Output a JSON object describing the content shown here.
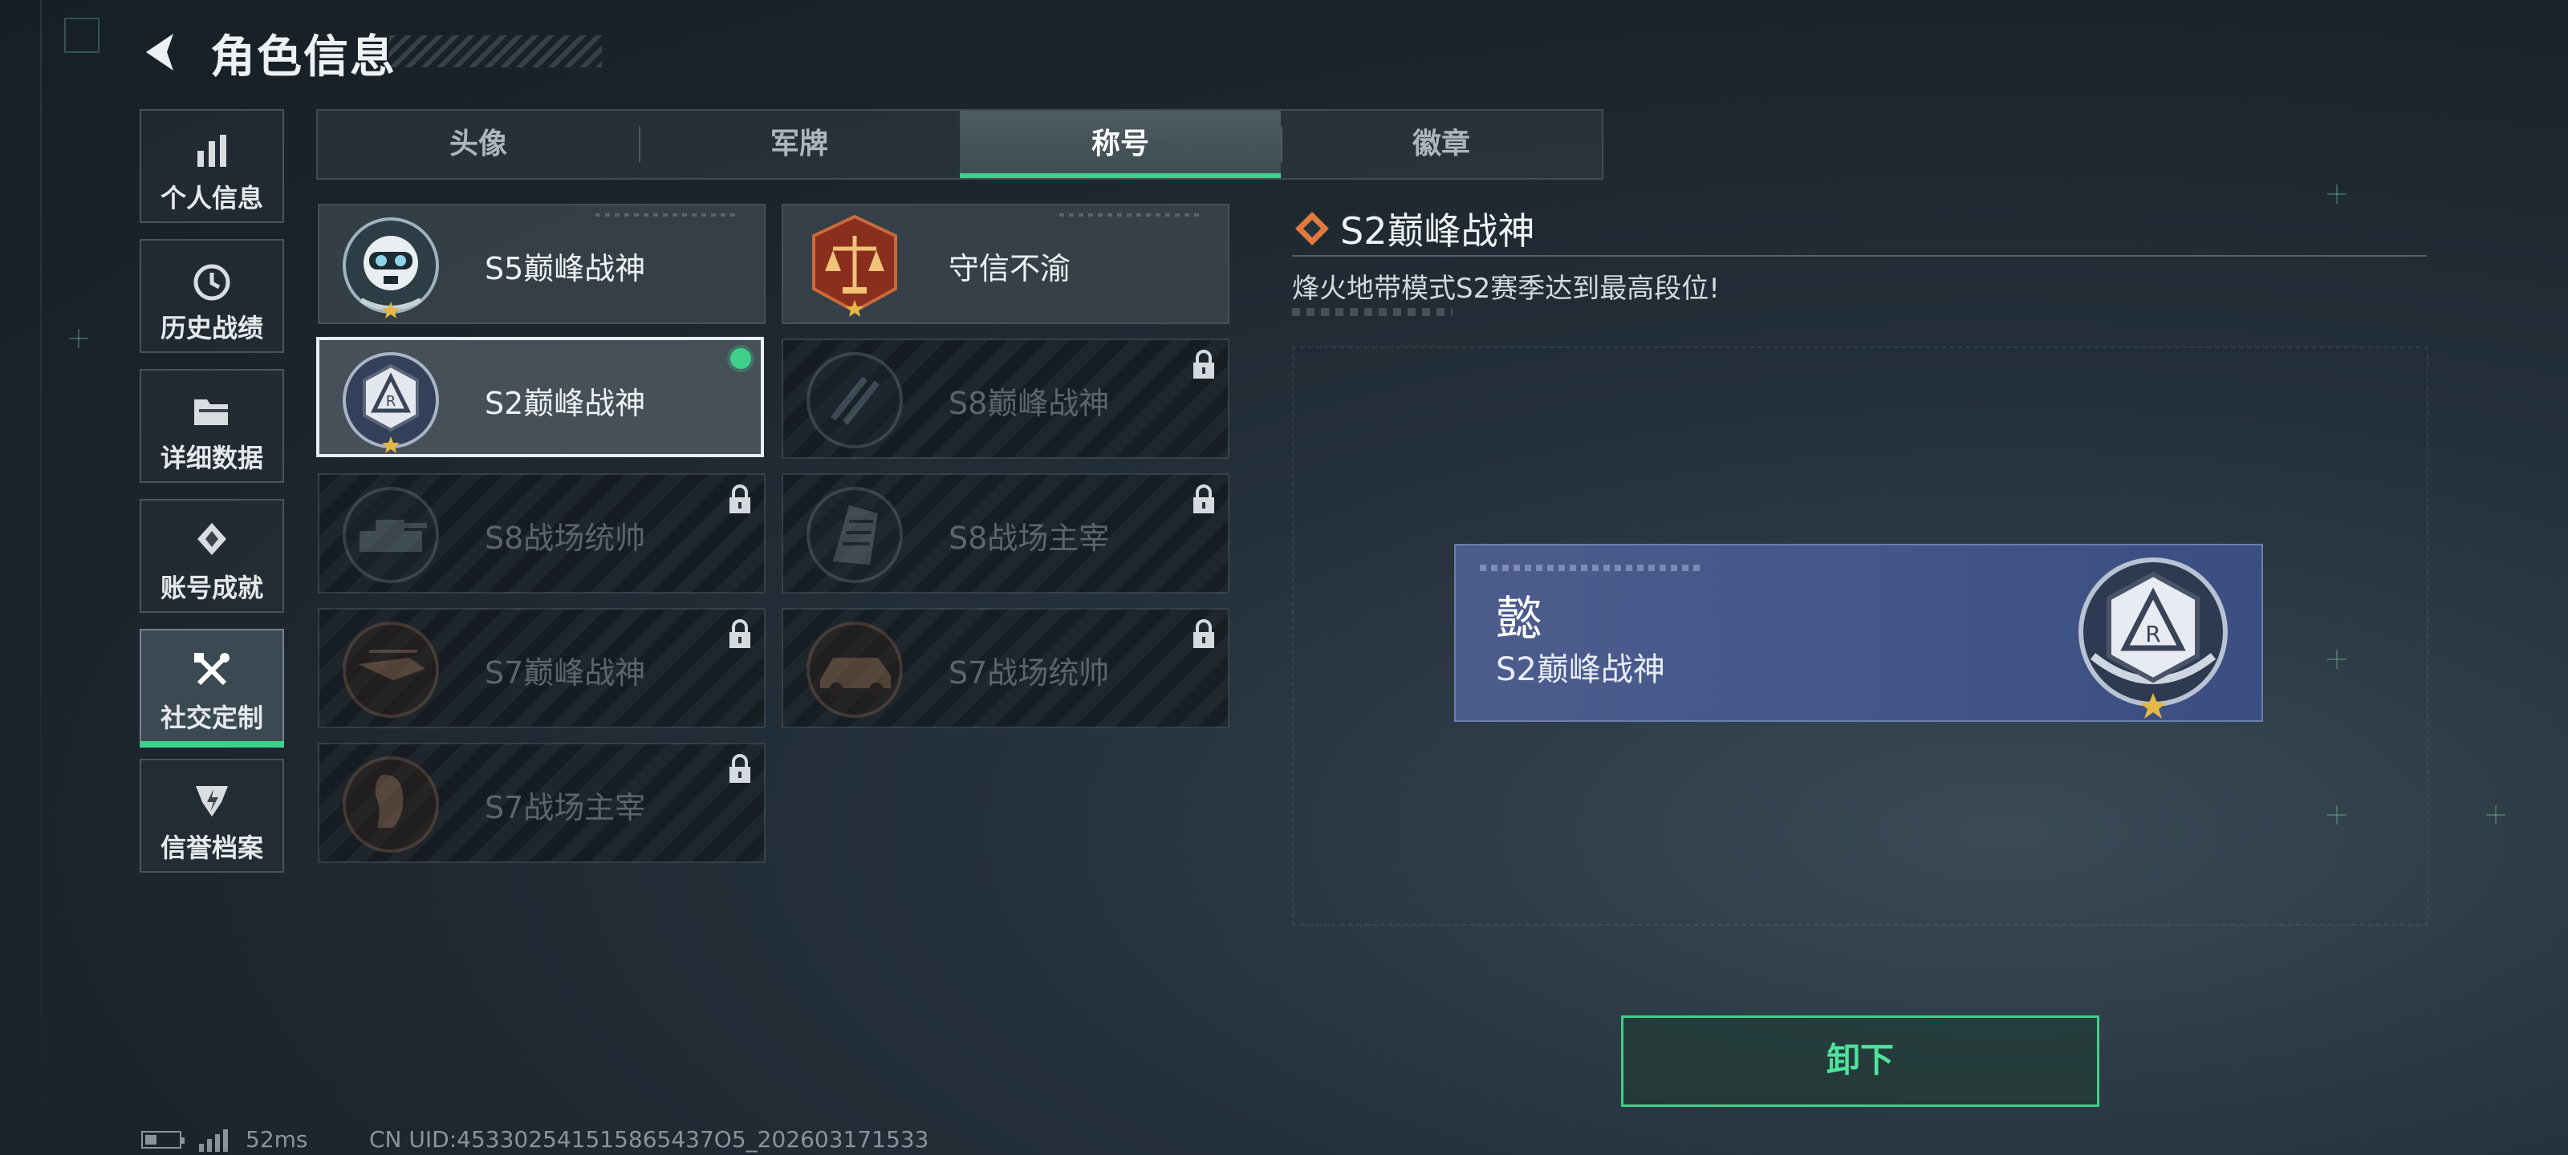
{
  "header": {
    "title": "角色信息"
  },
  "sidebar": {
    "items": [
      {
        "label": "个人信息",
        "icon": "bar-chart-icon"
      },
      {
        "label": "历史战绩",
        "icon": "history-clock-icon"
      },
      {
        "label": "详细数据",
        "icon": "folder-icon"
      },
      {
        "label": "账号成就",
        "icon": "achievement-icon"
      },
      {
        "label": "社交定制",
        "icon": "tools-icon",
        "active": true
      },
      {
        "label": "信誉档案",
        "icon": "credit-shield-icon"
      }
    ]
  },
  "tabs": [
    {
      "label": "头像"
    },
    {
      "label": "军牌"
    },
    {
      "label": "称号",
      "active": true
    },
    {
      "label": "徽章"
    }
  ],
  "titles": [
    {
      "name": "S5巅峰战神",
      "locked": false,
      "emblem": "diver-skull-emblem"
    },
    {
      "name": "守信不渝",
      "locked": false,
      "emblem": "scales-emblem"
    },
    {
      "name": "S2巅峰战神",
      "locked": false,
      "selected": true,
      "equipped": true,
      "emblem": "r-badge-emblem"
    },
    {
      "name": "S8巅峰战神",
      "locked": true,
      "emblem": "slash-emblem"
    },
    {
      "name": "S8战场统帅",
      "locked": true,
      "emblem": "tank-emblem"
    },
    {
      "name": "S8战场主宰",
      "locked": true,
      "emblem": "building-emblem"
    },
    {
      "name": "S7巅峰战神",
      "locked": true,
      "emblem": "helicopter-emblem"
    },
    {
      "name": "S7战场统帅",
      "locked": true,
      "emblem": "vehicle-emblem"
    },
    {
      "name": "S7战场主宰",
      "locked": true,
      "emblem": "statue-emblem"
    }
  ],
  "detail": {
    "title": "S2巅峰战神",
    "description": "烽火地带模式S2赛季达到最高段位!",
    "preview_char": "懿",
    "preview_title": "S2巅峰战神",
    "unload_label": "卸下"
  },
  "footer": {
    "ping": "52ms",
    "uid": "CN UID:453302541515865437O5_202603171533"
  },
  "colors": {
    "accent": "#3fd08a",
    "preview_bg": "#43558a"
  }
}
